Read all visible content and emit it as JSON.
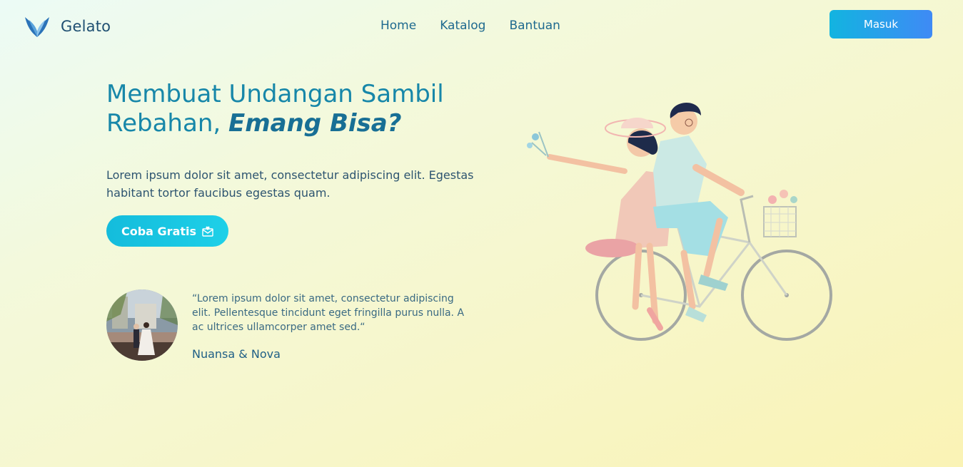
{
  "brand": {
    "name": "Gelato",
    "logo_icon": "wings-icon"
  },
  "nav": {
    "links": [
      {
        "label": "Home"
      },
      {
        "label": "Katalog"
      },
      {
        "label": "Bantuan"
      }
    ],
    "login_label": "Masuk"
  },
  "hero": {
    "title_line1": "Membuat Undangan Sambil",
    "title_line2_prefix": "Rebahan, ",
    "title_line2_emphasis": "Emang Bisa?",
    "description": "Lorem ipsum dolor sit amet, consectetur adipiscing elit. Egestas habitant tortor faucibus egestas quam.",
    "cta_label": "Coba Gratis",
    "cta_icon": "envelope-heart-icon"
  },
  "testimonial": {
    "quote": "“Lorem ipsum dolor sit amet, consectetur adipiscing elit. Pellentesque tincidunt eget fringilla purus nulla. A ac ultrices ullamcorper amet sed.“",
    "author": "Nuansa & Nova"
  },
  "colors": {
    "accent": "#1787a9",
    "login_gradient_start": "#12b4e0",
    "login_gradient_end": "#3f8af5",
    "cta": "#14bcdc"
  }
}
